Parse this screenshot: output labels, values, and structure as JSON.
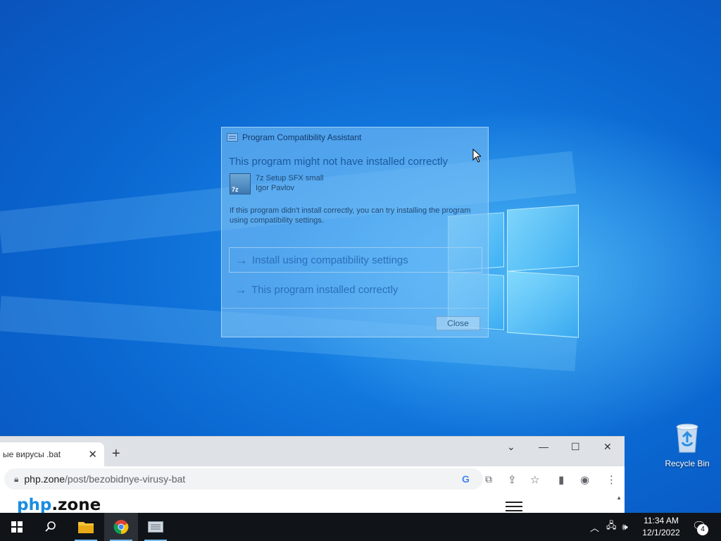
{
  "desktop": {
    "recycle_bin_label": "Recycle Bin"
  },
  "dialog": {
    "title": "Program Compatibility Assistant",
    "heading": "This program might not have installed correctly",
    "app_name": "7z Setup SFX small",
    "app_publisher": "Igor Pavlov",
    "description": "If this program didn't install correctly, you can try installing the program using compatibility settings.",
    "option_1": "Install using compatibility settings",
    "option_2": "This program installed correctly",
    "close_label": "Close"
  },
  "browser": {
    "tab_title": "ые вирусы .bat",
    "url_host": "php.zone",
    "url_path": "/post/bezobidnye-virusy-bat",
    "site_logo_php": "php",
    "site_logo_zone": ".zone"
  },
  "taskbar": {
    "time": "11:34 AM",
    "date": "12/1/2022",
    "notification_count": "4"
  },
  "colors": {
    "accent": "#0a66d0",
    "taskbar": "#101418",
    "link": "#2a6fb8"
  }
}
